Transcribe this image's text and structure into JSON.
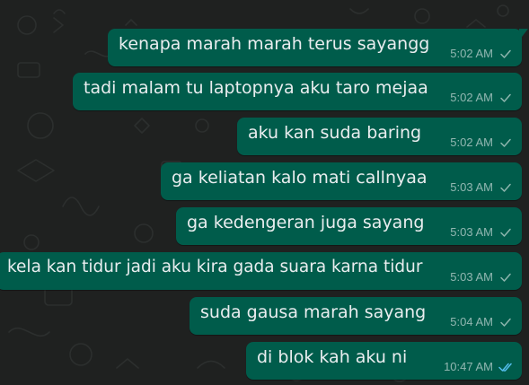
{
  "colors": {
    "bubble_out": "#005c4b",
    "background": "#1f2120",
    "text": "#e9edef",
    "read_check": "#53bdeb",
    "sent_check": "#8cb5ad"
  },
  "messages": [
    {
      "text": "kenapa marah marah terus sayangg",
      "time": "5:02 AM",
      "status": "delivered-icon"
    },
    {
      "text": "tadi malam tu laptopnya aku taro mejaa",
      "time": "5:02 AM",
      "status": "delivered-icon"
    },
    {
      "text": "aku kan suda baring",
      "time": "5:02 AM",
      "status": "delivered-icon"
    },
    {
      "text": "ga keliatan kalo mati callnyaa",
      "time": "5:03 AM",
      "status": "delivered-icon"
    },
    {
      "text": "ga kedengeran juga sayang",
      "time": "5:03 AM",
      "status": "delivered-icon"
    },
    {
      "text": "kela kan tidur jadi aku kira gada suara karna tidur",
      "time": "5:03 AM",
      "status": "delivered-icon"
    },
    {
      "text": "suda gausa marah sayang",
      "time": "5:04 AM",
      "status": "delivered-icon"
    },
    {
      "text": "di blok kah aku ni",
      "time": "10:47 AM",
      "status": "read-icon"
    }
  ]
}
